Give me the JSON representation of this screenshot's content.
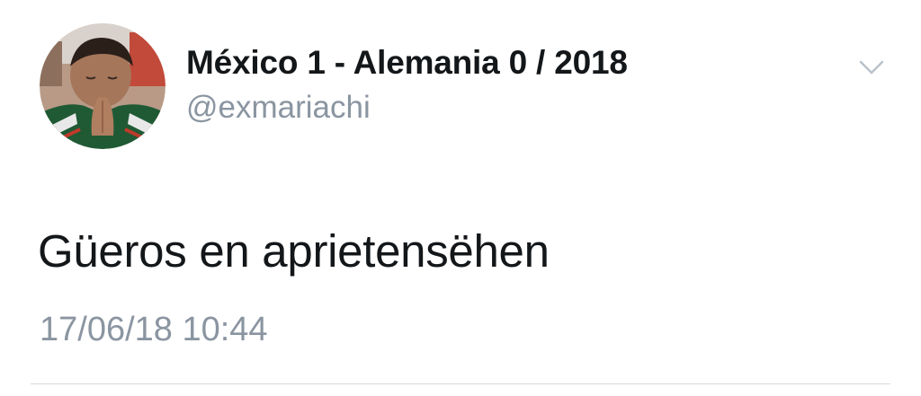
{
  "tweet": {
    "display_name": "México 1 - Alemania 0 / 2018",
    "handle": "@exmariachi",
    "text": "Güeros en aprietensëhen",
    "timestamp": "17/06/18 10:44"
  },
  "icons": {
    "avatar": "profile-photo",
    "more": "chevron-down-icon"
  },
  "colors": {
    "text_primary": "#14171a",
    "text_secondary": "#8a95a1",
    "divider": "#d6dbe0"
  }
}
